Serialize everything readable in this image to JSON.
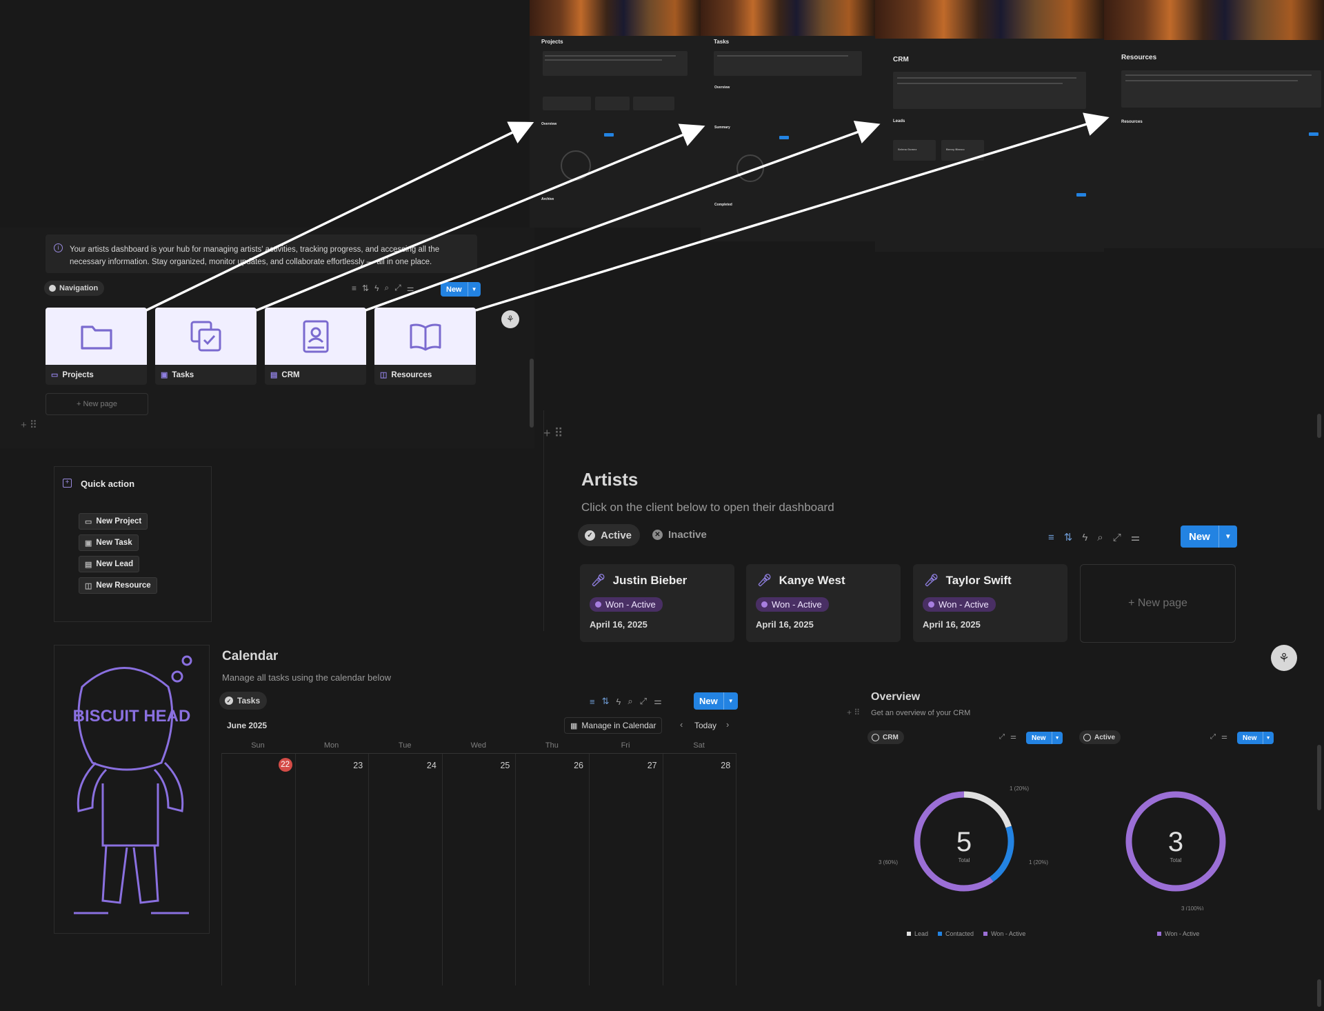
{
  "thumbnails": [
    {
      "title": "Projects",
      "stat_label": "Overview",
      "sub_label": "Archive"
    },
    {
      "title": "Tasks",
      "stat_label": "Overview",
      "sub_label": "Summary",
      "sub_label2": "Completed"
    },
    {
      "title": "CRM",
      "stat_label": "Leads",
      "lead1": "Selena Gomez",
      "lead2": "Benny Blanco"
    },
    {
      "title": "Resources",
      "stat_label": "Resources"
    }
  ],
  "dashboard": {
    "info_text": "Your artists dashboard is your hub for managing artists' activities, tracking progress, and accessing all the necessary information. Stay organized, monitor updates, and collaborate effortlessly — all in one place.",
    "nav_tag": "Navigation",
    "new_label": "New",
    "cards": [
      {
        "label": "Projects",
        "icon": "folder-icon"
      },
      {
        "label": "Tasks",
        "icon": "tasks-icon"
      },
      {
        "label": "CRM",
        "icon": "contact-book-icon"
      },
      {
        "label": "Resources",
        "icon": "book-open-icon"
      }
    ],
    "new_page": "+ New page"
  },
  "quick_action": {
    "title": "Quick action",
    "buttons": [
      {
        "label": "New Project",
        "icon": "folder-icon"
      },
      {
        "label": "New Task",
        "icon": "tasks-icon"
      },
      {
        "label": "New Lead",
        "icon": "contact-book-icon"
      },
      {
        "label": "New Resource",
        "icon": "book-open-icon"
      }
    ]
  },
  "artists": {
    "title": "Artists",
    "subtitle": "Click on the client below to open their dashboard",
    "tabs": [
      "Active",
      "Inactive"
    ],
    "new_label": "New",
    "cards": [
      {
        "name": "Justin Bieber",
        "status": "Won - Active",
        "date": "April 16, 2025"
      },
      {
        "name": "Kanye West",
        "status": "Won - Active",
        "date": "April 16, 2025"
      },
      {
        "name": "Taylor Swift",
        "status": "Won - Active",
        "date": "April 16, 2025"
      }
    ],
    "new_page": "+ New page"
  },
  "logo": {
    "text": "BISCUIT HEAD",
    "color": "#8a70e0"
  },
  "calendar": {
    "title": "Calendar",
    "subtitle": "Manage all tasks using the calendar below",
    "tag": "Tasks",
    "new_label": "New",
    "month": "June 2025",
    "manage_label": "Manage in Calendar",
    "today_label": "Today",
    "days": [
      "Sun",
      "Mon",
      "Tue",
      "Wed",
      "Thu",
      "Fri",
      "Sat"
    ],
    "dates": [
      "22",
      "23",
      "24",
      "25",
      "26",
      "27",
      "28"
    ],
    "today_index": 0
  },
  "overview": {
    "title": "Overview",
    "subtitle": "Get an overview of your CRM",
    "chart1_tag": "CRM",
    "chart2_tag": "Active",
    "new_label": "New",
    "total_label": "Total"
  },
  "chart_data": [
    {
      "type": "pie",
      "categories": [
        "Lead",
        "Contacted",
        "Won - Active"
      ],
      "values": [
        1,
        1,
        3
      ],
      "labels": [
        "1 (20%)",
        "1 (20%)",
        "3 (60%)"
      ],
      "center_value": "5",
      "center_label": "Total",
      "colors": [
        "#e0e0e0",
        "#2383e2",
        "#9b6fd6"
      ],
      "legend": "bottom"
    },
    {
      "type": "pie",
      "categories": [
        "Won - Active"
      ],
      "values": [
        3
      ],
      "labels": [
        "3 (100%)"
      ],
      "center_value": "3",
      "center_label": "Total",
      "colors": [
        "#9b6fd6"
      ],
      "legend": "bottom"
    }
  ],
  "colors": {
    "accent": "#2383e2",
    "purple": "#9b6fd6",
    "bg": "#191919"
  }
}
